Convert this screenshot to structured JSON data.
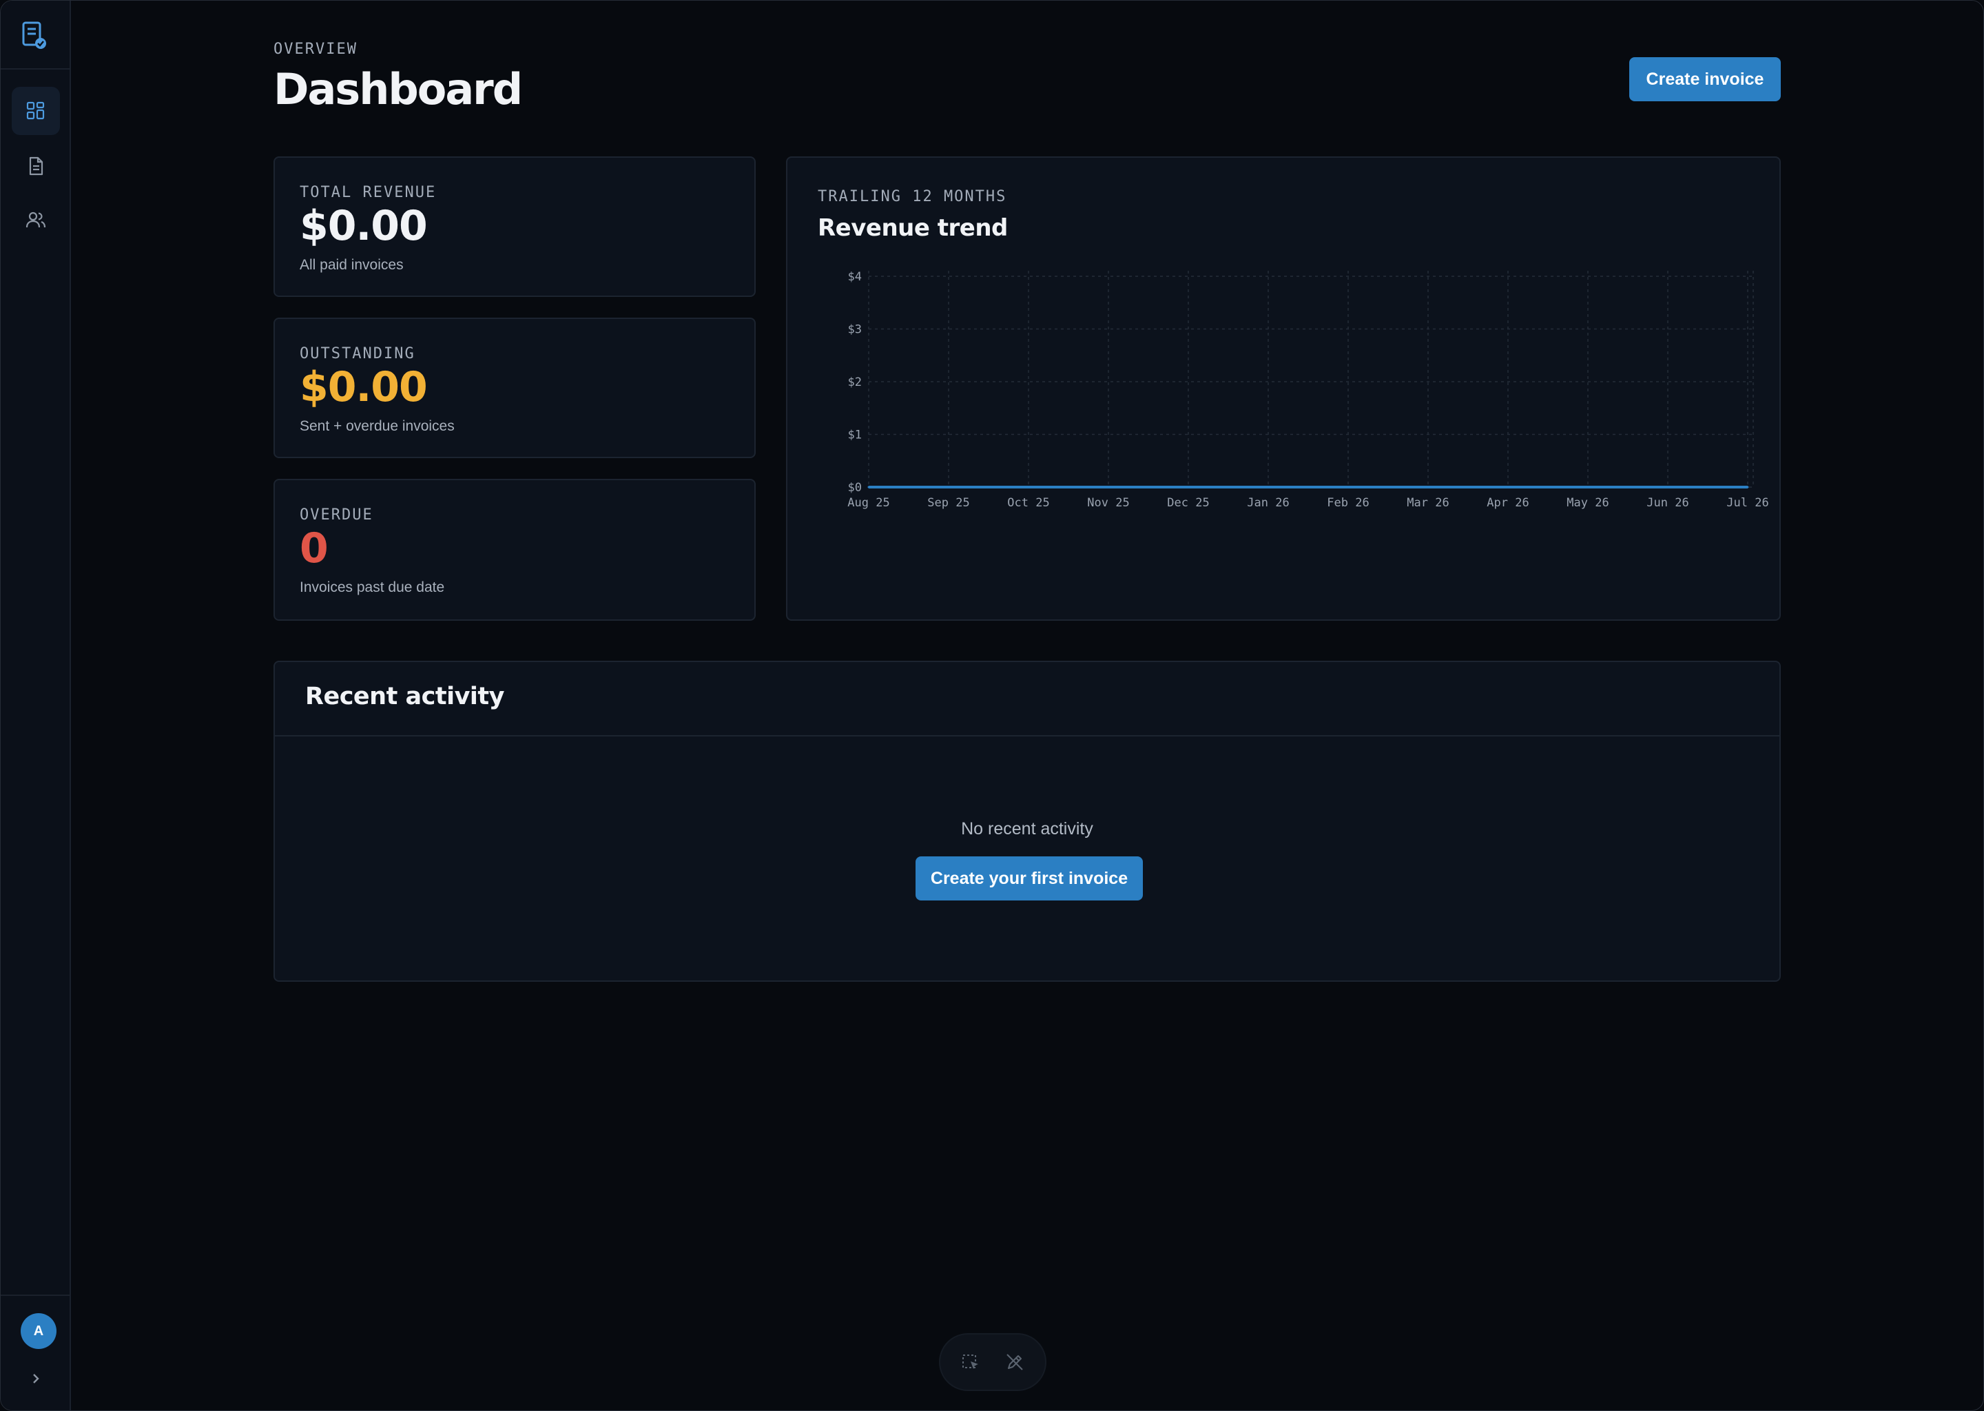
{
  "header": {
    "eyebrow": "OVERVIEW",
    "title": "Dashboard",
    "create_button": "Create invoice"
  },
  "sidebar": {
    "items": [
      {
        "name": "dashboard",
        "icon": "grid-icon",
        "active": true
      },
      {
        "name": "invoices",
        "icon": "document-icon",
        "active": false
      },
      {
        "name": "clients",
        "icon": "users-icon",
        "active": false
      }
    ],
    "avatar_initial": "A"
  },
  "stats": [
    {
      "label": "TOTAL REVENUE",
      "value": "$0.00",
      "sub": "All paid invoices",
      "color": "#f1f3f6"
    },
    {
      "label": "OUTSTANDING",
      "value": "$0.00",
      "sub": "Sent + overdue invoices",
      "color": "#f2b135"
    },
    {
      "label": "OVERDUE",
      "value": "0",
      "sub": "Invoices past due date",
      "color": "#e05548"
    }
  ],
  "chart": {
    "eyebrow": "TRAILING 12 MONTHS",
    "title": "Revenue trend"
  },
  "chart_data": {
    "type": "line",
    "categories": [
      "Aug 25",
      "Sep 25",
      "Oct 25",
      "Nov 25",
      "Dec 25",
      "Jan 26",
      "Feb 26",
      "Mar 26",
      "Apr 26",
      "May 26",
      "Jun 26",
      "Jul 26"
    ],
    "series": [
      {
        "values": [
          0,
          0,
          0,
          0,
          0,
          0,
          0,
          0,
          0,
          0,
          0,
          0
        ]
      }
    ],
    "yticks": [
      "$0",
      "$1",
      "$2",
      "$3",
      "$4"
    ],
    "ylim": [
      0,
      4
    ],
    "grid": true,
    "line_color": "#2b7fc3"
  },
  "activity": {
    "title": "Recent activity",
    "empty_text": "No recent activity",
    "cta": "Create your first invoice"
  },
  "colors": {
    "accent": "#2b7fc3",
    "background": "#070a0f",
    "card": "#0c121c"
  }
}
